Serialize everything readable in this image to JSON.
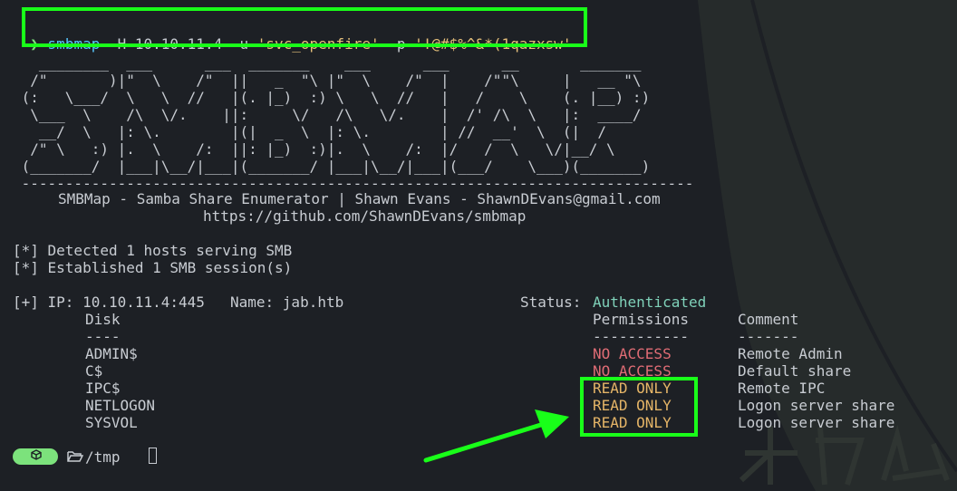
{
  "prompt_glyph": "❯",
  "command": {
    "program": "smbmap",
    "args": " -H 10.10.11.4 -u ",
    "user": "'svc_openfire'",
    "pass_flag": " -p ",
    "password": "'!@#$%^&*(1qazxsw'"
  },
  "banner": {
    "ascii": "   ________  ___      ___  _______    ___      ___      __       _______\n  /\"       )|\"  \\    /\"  ||   _  \"\\ |\"  \\    /\"  |    /\"\"\\     |   __ \"\\\n (:   \\___/  \\   \\  //   |(. |_)  :) \\   \\  //   |   /    \\    (. |__) :)\n  \\___  \\    /\\  \\/.    ||:     \\/   /\\   \\/.    |  /' /\\  \\   |:  ____/\n   __/  \\   |: \\.        |(|  _  \\  |: \\.        | //  __'  \\  (|  /\n  /\" \\   :) |.  \\    /:  ||: |_)  :)|.  \\    /:  |/   /  \\   \\/|__/ \\\n (_______/  |___|\\__/|___|(_______/ |___|\\__/|___|(___/    \\___)(_______)\n -----------------------------------------------------------------------------",
    "subtitle": "SMBMap - Samba Share Enumerator | Shawn Evans - ShawnDEvans@gmail.com",
    "url": "https://github.com/ShawnDEvans/smbmap"
  },
  "status_lines": [
    "[*] Detected 1 hosts serving SMB",
    "[*] Established 1 SMB session(s)"
  ],
  "host": {
    "prefix": "[+] IP: 10.10.11.4:445",
    "name": "Name: jab.htb",
    "status_label": "Status:",
    "status_value": "Authenticated"
  },
  "table": {
    "headers": {
      "disk": "Disk",
      "permissions": "Permissions",
      "comment": "Comment"
    },
    "separators": {
      "disk": "----",
      "permissions": "-----------",
      "comment": "-------"
    },
    "rows": [
      {
        "disk": "ADMIN$",
        "permissions": "NO ACCESS",
        "comment": "Remote Admin"
      },
      {
        "disk": "C$",
        "permissions": "NO ACCESS",
        "comment": "Default share"
      },
      {
        "disk": "IPC$",
        "permissions": "READ ONLY",
        "comment": "Remote IPC"
      },
      {
        "disk": "NETLOGON",
        "permissions": "READ ONLY",
        "comment": "Logon server share"
      },
      {
        "disk": "SYSVOL",
        "permissions": "READ ONLY",
        "comment": "Logon server share"
      }
    ]
  },
  "prompt": {
    "path": "/tmp"
  },
  "colors": {
    "background": "#1d2025",
    "highlight": "#19ff19",
    "authenticated": "#7fd1b9",
    "no_access": "#e06c75",
    "read_only": "#e5b567"
  }
}
